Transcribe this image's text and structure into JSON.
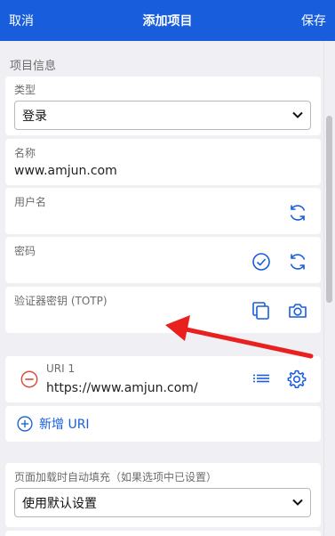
{
  "header": {
    "cancel": "取消",
    "title": "添加项目",
    "save": "保存"
  },
  "section": {
    "title": "项目信息"
  },
  "type_field": {
    "label": "类型",
    "value": "登录"
  },
  "name_field": {
    "label": "名称",
    "value": "www.amjun.com"
  },
  "username_field": {
    "label": "用户名",
    "value": ""
  },
  "password_field": {
    "label": "密码",
    "value": ""
  },
  "totp_field": {
    "label": "验证器密钥 (TOTP)",
    "value": ""
  },
  "uri": {
    "label": "URI 1",
    "value": "https://www.amjun.com/",
    "add_label": "新增 URI"
  },
  "autofill": {
    "label": "页面加载时自动填充（如果选项中已设置）",
    "value": "使用默认设置"
  },
  "colors": {
    "brand": "#175ddc",
    "danger": "#dd4b39",
    "annotation": "#e8211f"
  },
  "icons": [
    "refresh-icon",
    "check-circle-icon",
    "copy-icon",
    "camera-icon",
    "minus-circle-icon",
    "list-icon",
    "gear-icon",
    "plus-circle-icon",
    "chevron-down-icon"
  ]
}
